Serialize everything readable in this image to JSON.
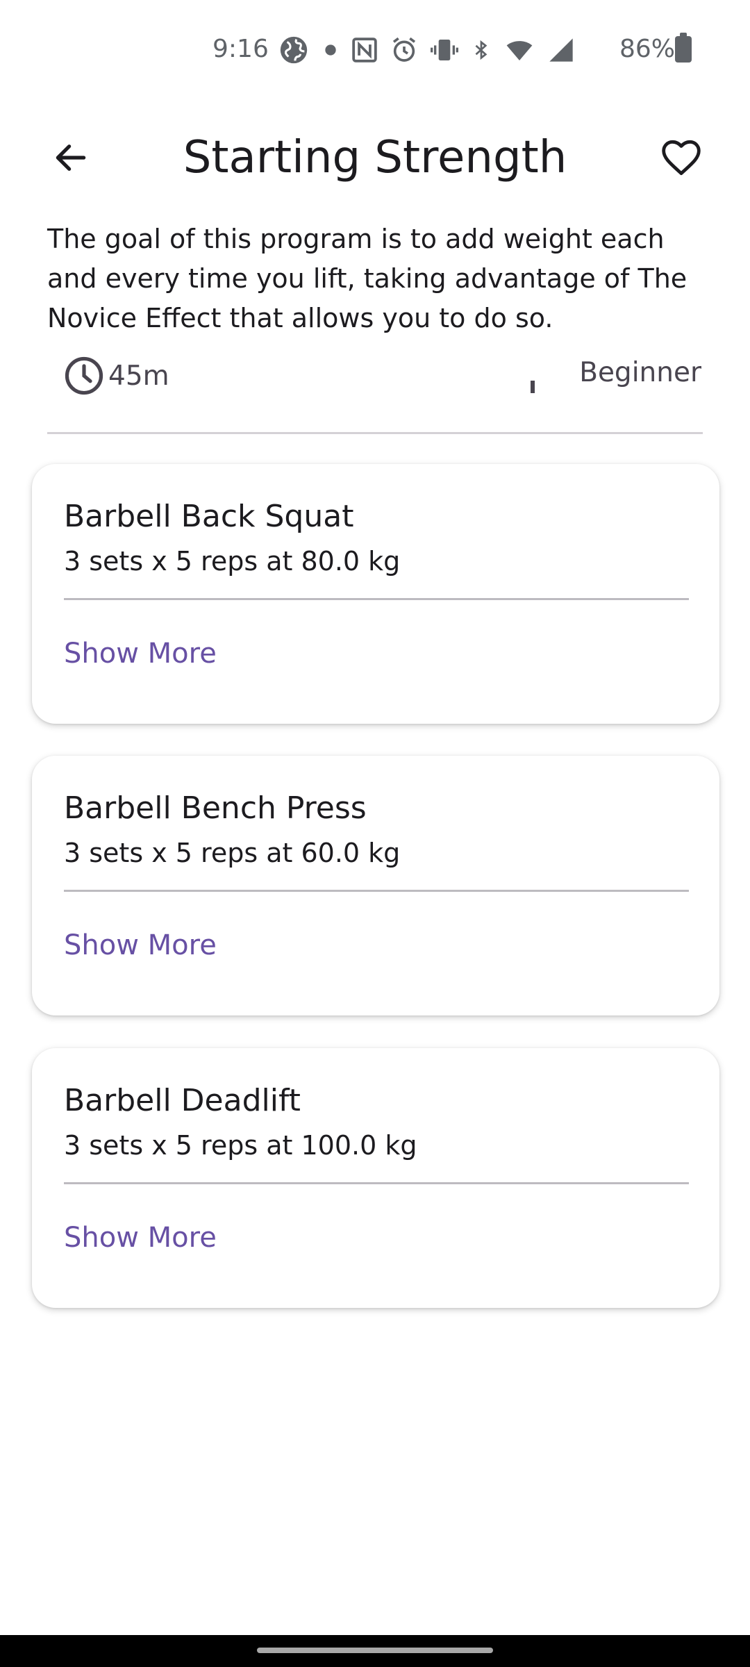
{
  "status_bar": {
    "time": "9:16",
    "battery": "86%",
    "icons": [
      "globe-icon",
      "dot-icon",
      "nfc-icon",
      "alarm-icon",
      "vibrate-icon",
      "bluetooth-icon",
      "wifi-icon",
      "signal-icon",
      "battery-icon"
    ]
  },
  "header": {
    "title": "Starting Strength",
    "back_icon": "arrow-left-icon",
    "favorite_icon": "heart-outline-icon"
  },
  "program": {
    "description": "The goal of this program is to add weight each and every time you lift, taking advantage of The Novice Effect that allows you to do so.",
    "duration": "45m",
    "level": "Beginner"
  },
  "exercises": [
    {
      "name": "Barbell Back Squat",
      "detail": "3 sets x 5 reps at 80.0 kg",
      "action": "Show More"
    },
    {
      "name": "Barbell Bench Press",
      "detail": "3 sets x 5 reps at 60.0 kg",
      "action": "Show More"
    },
    {
      "name": "Barbell Deadlift",
      "detail": "3 sets x 5 reps at 100.0 kg",
      "action": "Show More"
    }
  ],
  "colors": {
    "accent": "#6750a4",
    "text": "#1c1b1f",
    "secondary_text": "#49454f"
  }
}
